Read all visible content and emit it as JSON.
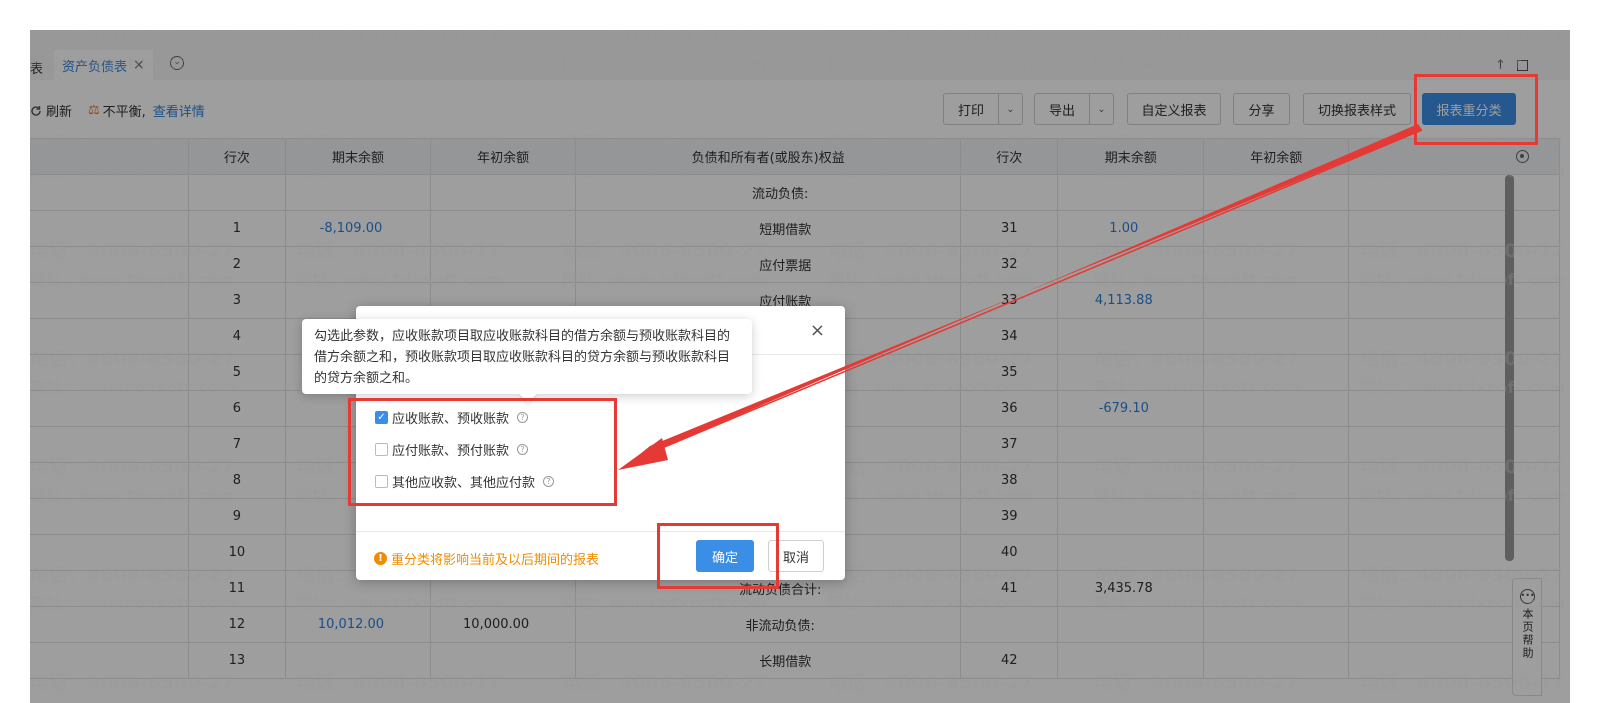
{
  "tabs": {
    "left_fragment": "表",
    "active": "资产负债表",
    "close": "×",
    "more": "⌄"
  },
  "window": {
    "up": "↑"
  },
  "toolbar": {
    "refresh": "刷新",
    "unbalanced": "不平衡,",
    "details": "查看详情",
    "print": "打印",
    "export": "导出",
    "custom_report": "自定义报表",
    "share": "分享",
    "switch_style": "切换报表样式",
    "reclassify": "报表重分类",
    "caret": "⌄"
  },
  "table": {
    "headers": [
      "行次",
      "期末余额",
      "年初余额",
      "负债和所有者(或股东)权益",
      "行次",
      "期末余额",
      "年初余额"
    ],
    "rows": [
      {
        "row1": "",
        "end1": "",
        "begin1": "",
        "label": "流动负债:",
        "row2": "",
        "end2": "",
        "begin2": ""
      },
      {
        "row1": "1",
        "end1": "-8,109.00",
        "begin1": "",
        "label": "短期借款",
        "row2": "31",
        "end2": "1.00",
        "begin2": ""
      },
      {
        "row1": "2",
        "end1": "",
        "begin1": "",
        "label": "应付票据",
        "row2": "32",
        "end2": "",
        "begin2": ""
      },
      {
        "row1": "3",
        "end1": "",
        "begin1": "",
        "label": "应付账款",
        "row2": "33",
        "end2": "4,113.88",
        "begin2": ""
      },
      {
        "row1": "4",
        "end1": "",
        "begin1": "",
        "label": "",
        "row2": "34",
        "end2": "",
        "begin2": ""
      },
      {
        "row1": "5",
        "end1": "",
        "begin1": "",
        "label": "",
        "row2": "35",
        "end2": "",
        "begin2": ""
      },
      {
        "row1": "6",
        "end1": "",
        "begin1": "",
        "label": "",
        "row2": "36",
        "end2": "-679.10",
        "begin2": ""
      },
      {
        "row1": "7",
        "end1": "",
        "begin1": "",
        "label": "",
        "row2": "37",
        "end2": "",
        "begin2": ""
      },
      {
        "row1": "8",
        "end1": "",
        "begin1": "",
        "label": "",
        "row2": "38",
        "end2": "",
        "begin2": ""
      },
      {
        "row1": "9",
        "end1": "",
        "begin1": "",
        "label": "",
        "row2": "39",
        "end2": "",
        "begin2": ""
      },
      {
        "row1": "10",
        "end1": "",
        "begin1": "",
        "label": "",
        "row2": "40",
        "end2": "",
        "begin2": ""
      },
      {
        "row1": "11",
        "end1": "",
        "begin1": "",
        "label": "流动负债合计:",
        "row2": "41",
        "end2": "3,435.78",
        "begin2": ""
      },
      {
        "row1": "12",
        "end1": "10,012.00",
        "begin1": "10,000.00",
        "label": "非流动负债:",
        "row2": "",
        "end2": "",
        "begin2": ""
      },
      {
        "row1": "13",
        "end1": "",
        "begin1": "",
        "label": "长期借款",
        "row2": "42",
        "end2": "",
        "begin2": ""
      }
    ]
  },
  "modal": {
    "close": "×",
    "options": [
      {
        "label": "应收账款、预收账款",
        "checked": true
      },
      {
        "label": "应付账款、预付账款",
        "checked": false
      },
      {
        "label": "其他应收款、其他应付款",
        "checked": false
      }
    ],
    "warning": "重分类将影响当前及以后期间的报表",
    "confirm": "确定",
    "cancel": "取消"
  },
  "tooltip": {
    "text": "勾选此参数，应收账款项目取应收账款科目的借方余额与预收账款科目的借方余额之和，预收账款项目取应收账款科目的贷方余额与预收账款科目的贷方余额之和。"
  },
  "help": {
    "label": "本页帮助"
  },
  "watermark": {
    "phone": "电话：4006-6500-27",
    "site": "网址：www.tdxsoft.com"
  },
  "colors": {
    "accent": "#3a8ee6",
    "link": "#2e7fd8",
    "warning": "#f08c00",
    "annotation": "#e53935"
  }
}
